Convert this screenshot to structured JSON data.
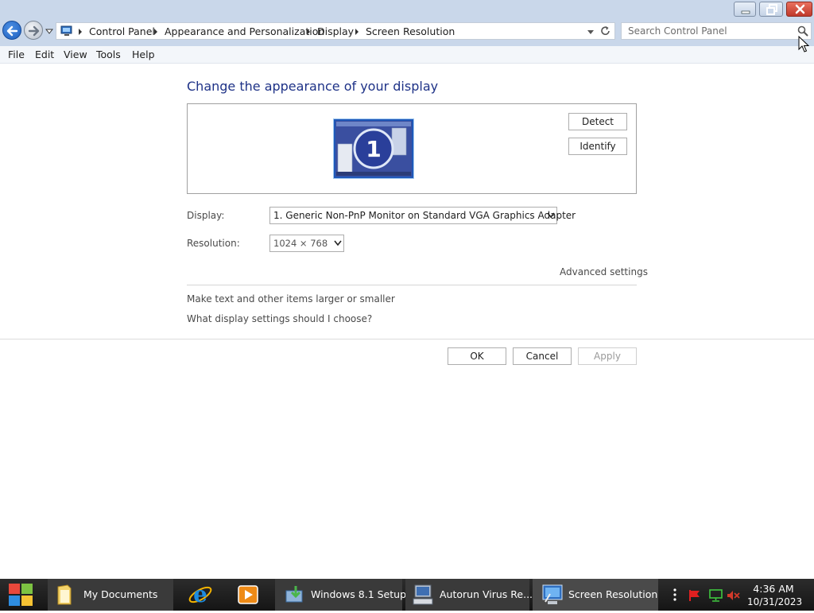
{
  "window": {
    "minimize_icon": "minimize-icon",
    "maximize_icon": "restore-icon",
    "close_icon": "close-icon"
  },
  "address_bar": {
    "breadcrumbs": [
      "Control Panel",
      "Appearance and Personalization",
      "Display",
      "Screen Resolution"
    ],
    "search_placeholder": "Search Control Panel"
  },
  "menu": [
    "File",
    "Edit",
    "View",
    "Tools",
    "Help"
  ],
  "content": {
    "title": "Change the appearance of your display",
    "monitor_number": "1",
    "detect_label": "Detect",
    "identify_label": "Identify",
    "display_label": "Display:",
    "display_value": "1. Generic Non-PnP Monitor on Standard VGA Graphics Adapter",
    "resolution_label": "Resolution:",
    "resolution_value": "1024 × 768",
    "advanced_link": "Advanced settings",
    "links": [
      "Make text and other items larger or smaller",
      "What display settings should I choose?"
    ],
    "ok_label": "OK",
    "cancel_label": "Cancel",
    "apply_label": "Apply"
  },
  "taskbar": {
    "items": [
      "My Documents",
      "Windows 8.1 Setup",
      "Autorun Virus Re...",
      "Screen Resolution"
    ],
    "clock_time": "4:36 AM",
    "clock_date": "10/31/2023"
  },
  "colors": {
    "title_bar": "#c9d7ea",
    "title_text": "#1e3287",
    "taskbar": "#1f1f1f",
    "close_button": "#c0392b"
  }
}
